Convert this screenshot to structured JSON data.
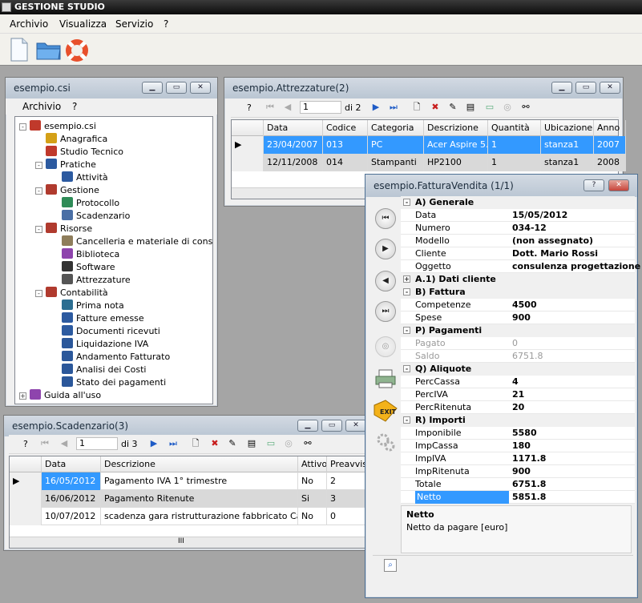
{
  "app": {
    "title": "GESTIONE STUDIO"
  },
  "menu": {
    "items": [
      "Archivio",
      "Visualizza",
      "Servizio",
      "?"
    ]
  },
  "toolbar": {
    "icons": [
      "new-document-icon",
      "open-folder-icon",
      "help-lifebuoy-icon"
    ]
  },
  "win_csi": {
    "title": "esempio.csi",
    "menu": [
      "Archivio",
      "?"
    ],
    "tree": [
      {
        "label": "esempio.csi",
        "icon": "house-icon",
        "color": "#c0392b"
      },
      {
        "label": "Anagrafica",
        "icon": "people-icon",
        "color": "#d4a017"
      },
      {
        "label": "Studio Tecnico",
        "icon": "house-icon",
        "color": "#c0392b"
      },
      {
        "label": "Pratiche",
        "icon": "list-icon",
        "color": "#2c5aa0"
      },
      {
        "label": "Attività",
        "icon": "list-icon",
        "color": "#2c5aa0"
      },
      {
        "label": "Gestione",
        "icon": "gear-building-icon",
        "color": "#b03a2e"
      },
      {
        "label": "Protocollo",
        "icon": "globe-icon",
        "color": "#2e8b57"
      },
      {
        "label": "Scadenzario",
        "icon": "calendar-icon",
        "color": "#4a6fa5"
      },
      {
        "label": "Risorse",
        "icon": "gear-building-icon",
        "color": "#b03a2e"
      },
      {
        "label": "Cancelleria e materiale di consumo",
        "icon": "pencil-icon",
        "color": "#8e7d5b"
      },
      {
        "label": "Biblioteca",
        "icon": "book-icon",
        "color": "#8e44ad"
      },
      {
        "label": "Software",
        "icon": "disk-icon",
        "color": "#333333"
      },
      {
        "label": "Attrezzature",
        "icon": "tools-icon",
        "color": "#555555"
      },
      {
        "label": "Contabilità",
        "icon": "gear-building-icon",
        "color": "#b03a2e"
      },
      {
        "label": "Prima nota",
        "icon": "register-icon",
        "color": "#2c6e91"
      },
      {
        "label": "Fatture emesse",
        "icon": "list-icon",
        "color": "#2c5aa0"
      },
      {
        "label": "Documenti ricevuti",
        "icon": "list-icon",
        "color": "#2c5aa0"
      },
      {
        "label": "Liquidazione IVA",
        "icon": "word-icon",
        "color": "#2b579a"
      },
      {
        "label": "Andamento Fatturato",
        "icon": "word-icon",
        "color": "#2b579a"
      },
      {
        "label": "Analisi dei Costi",
        "icon": "word-icon",
        "color": "#2b579a"
      },
      {
        "label": "Stato dei pagamenti",
        "icon": "word-icon",
        "color": "#2b579a"
      },
      {
        "label": "Guida all'uso",
        "icon": "book-icon",
        "color": "#8e44ad"
      }
    ]
  },
  "win_attr": {
    "title": "esempio.Attrezzature(2)",
    "nav": {
      "help": "?",
      "position": "1",
      "of": "di 2"
    },
    "columns": [
      "Data",
      "Codice",
      "Categoria",
      "Descrizione",
      "Quantità",
      "Ubicazione",
      "Anno"
    ],
    "rows": [
      [
        "23/04/2007",
        "013",
        "PC",
        "Acer Aspire 5...",
        "1",
        "stanza1",
        "2007"
      ],
      [
        "12/11/2008",
        "014",
        "Stampanti",
        "HP2100",
        "1",
        "stanza1",
        "2008"
      ]
    ]
  },
  "win_scad": {
    "title": "esempio.Scadenzario(3)",
    "nav": {
      "help": "?",
      "position": "1",
      "of": "di 3"
    },
    "columns": [
      "Data",
      "Descrizione",
      "Attivo",
      "Preavviso"
    ],
    "rows": [
      [
        "16/05/2012",
        "Pagamento IVA 1° trimestre",
        "No",
        "2"
      ],
      [
        "16/06/2012",
        "Pagamento Ritenute",
        "Si",
        "3"
      ],
      [
        "10/07/2012",
        "scadenza gara ristrutturazione fabbricato Cagliari",
        "No",
        "0"
      ]
    ],
    "scroll_glyph": "III"
  },
  "win_fatt": {
    "title": "esempio.FatturaVendita (1/1)",
    "help_btn": "?",
    "sections": [
      {
        "title": "A) Generale",
        "props": [
          [
            "Data",
            "15/05/2012"
          ],
          [
            "Numero",
            "034-12"
          ],
          [
            "Modello",
            "(non assegnato)"
          ],
          [
            "Cliente",
            "Dott. Mario Rossi"
          ],
          [
            "Oggetto",
            "consulenza progettazione"
          ]
        ]
      },
      {
        "title": "A.1) Dati cliente",
        "collapsed": true,
        "props": []
      },
      {
        "title": "B) Fattura",
        "props": [
          [
            "Competenze",
            "4500"
          ],
          [
            "Spese",
            "900"
          ]
        ]
      },
      {
        "title": "P) Pagamenti",
        "props": [
          [
            "Pagato",
            "0"
          ],
          [
            "Saldo",
            "6751.8"
          ]
        ],
        "disabled": true
      },
      {
        "title": "Q) Aliquote",
        "props": [
          [
            "PercCassa",
            "4"
          ],
          [
            "PercIVA",
            "21"
          ],
          [
            "PercRitenuta",
            "20"
          ]
        ]
      },
      {
        "title": "R) Importi",
        "props": [
          [
            "Imponibile",
            "5580"
          ],
          [
            "ImpCassa",
            "180"
          ],
          [
            "ImpIVA",
            "1171.8"
          ],
          [
            "ImpRitenuta",
            "900"
          ],
          [
            "Totale",
            "6751.8"
          ],
          [
            "Netto",
            "5851.8"
          ]
        ]
      }
    ],
    "desc": {
      "title": "Netto",
      "text": "Netto da pagare [euro]"
    },
    "side_buttons": [
      "first-record-icon",
      "play-icon",
      "previous-icon",
      "last-record-icon",
      "lifebuoy-icon",
      "printer-icon",
      "exit-tag-icon",
      "gears-icon"
    ],
    "exit_label": "EXIT"
  }
}
